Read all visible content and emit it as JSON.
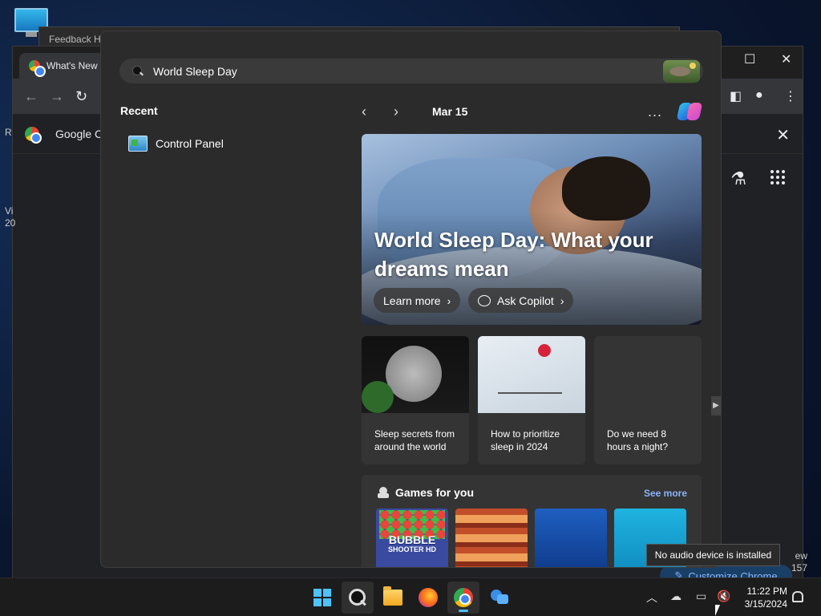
{
  "background_window": {
    "feedback_title": "Feedback Hu",
    "chrome_tab_title": "What's New",
    "bookmark_label": "Google Ch",
    "left_edge_texts": [
      "R",
      "Vi",
      "20"
    ],
    "right_edge_texts": [
      "ew",
      "157"
    ],
    "customize_label": "Customize Chrome"
  },
  "search": {
    "query": "World Sleep Day"
  },
  "recent": {
    "title": "Recent",
    "items": [
      {
        "label": "Control Panel"
      }
    ]
  },
  "feed": {
    "date": "Mar 15",
    "more": "...",
    "hero": {
      "title": "World Sleep Day: What your dreams mean",
      "learn_more": "Learn more",
      "ask_copilot": "Ask Copilot"
    },
    "cards": [
      {
        "caption": "Sleep secrets from around the world"
      },
      {
        "caption": "How to prioritize sleep in 2024"
      },
      {
        "caption": "Do we need 8 hours a night?"
      }
    ],
    "games": {
      "title": "Games for you",
      "see_more": "See more",
      "tile1_title": "BUBBLE",
      "tile1_subtitle": "SHOOTER HD"
    }
  },
  "tooltip": "No audio device is installed",
  "taskbar": {
    "time": "11:22 PM",
    "date": "3/15/2024"
  },
  "colors": {
    "accent": "#4cc2ff",
    "link": "#8ab4f8",
    "flyout_bg": "#2b2b2b"
  }
}
